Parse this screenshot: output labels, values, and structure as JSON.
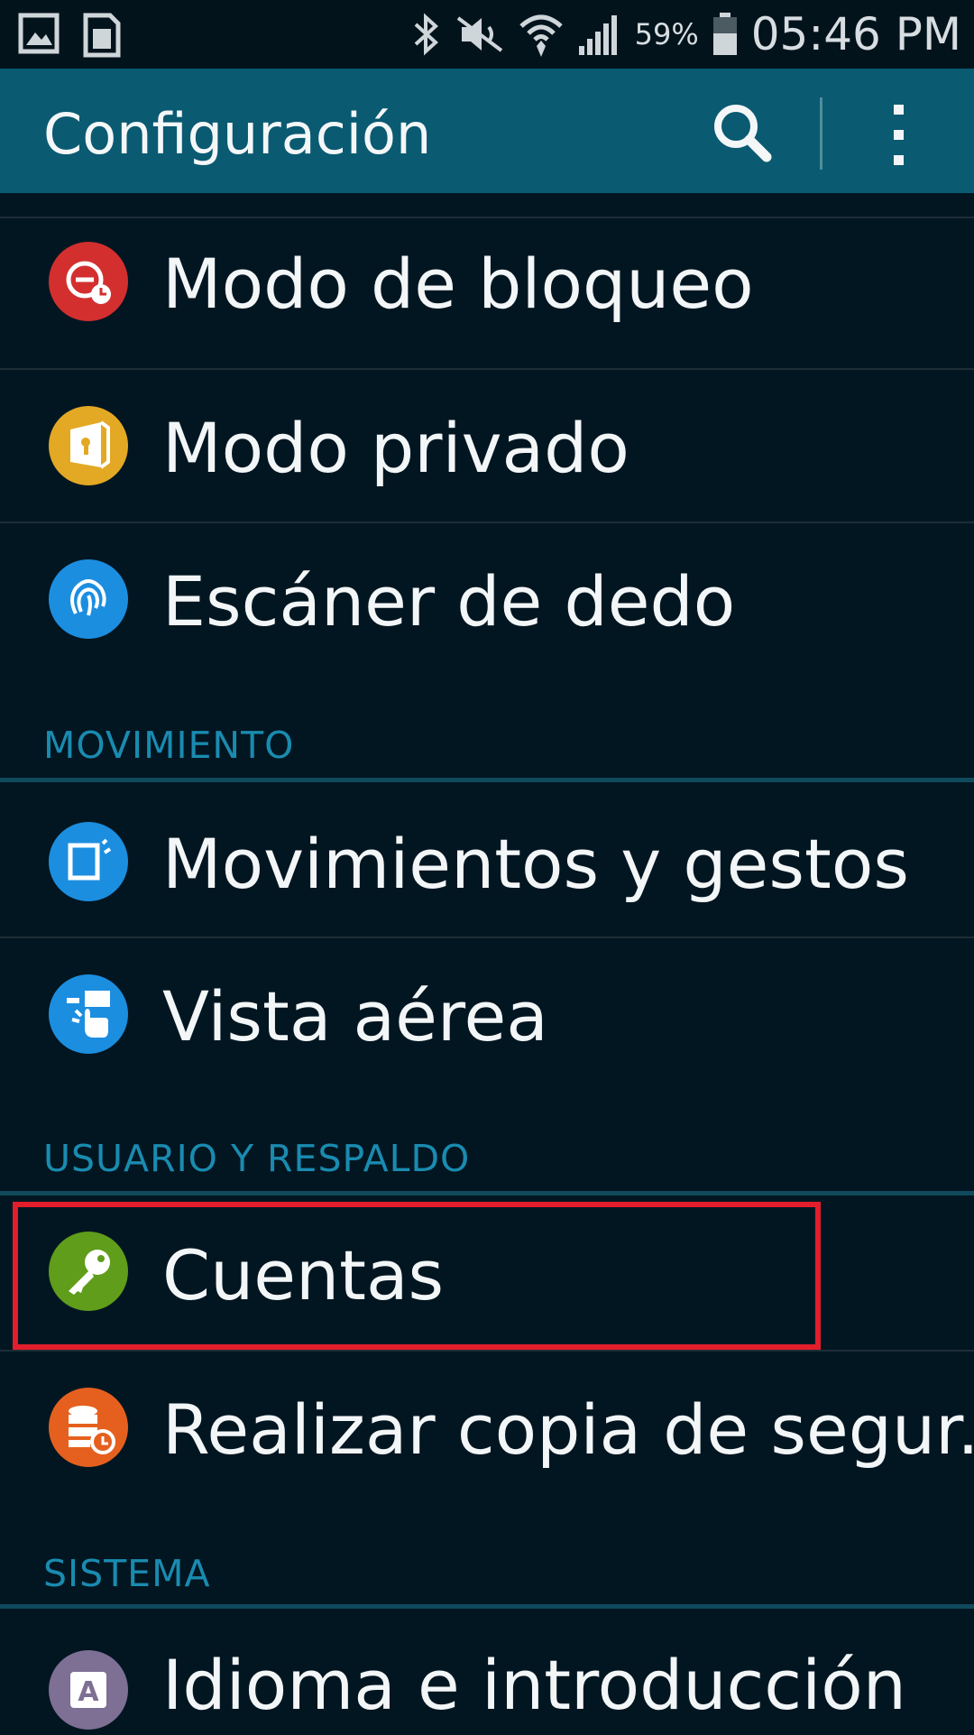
{
  "status_bar": {
    "battery_percent": "59%",
    "time": "05:46 PM"
  },
  "action_bar": {
    "title": "Configuración"
  },
  "sections": [
    {
      "header": "",
      "items": [
        {
          "label": "Modo de bloqueo",
          "icon": "blocking-mode-icon",
          "color": "#d32f2f"
        },
        {
          "label": "Modo privado",
          "icon": "private-mode-icon",
          "color": "#e3a824"
        },
        {
          "label": "Escáner de dedo",
          "icon": "fingerprint-icon",
          "color": "#1c8ee0"
        }
      ]
    },
    {
      "header": "MOVIMIENTO",
      "items": [
        {
          "label": "Movimientos y gestos",
          "icon": "motions-gestures-icon",
          "color": "#1c8ee0"
        },
        {
          "label": "Vista aérea",
          "icon": "air-view-icon",
          "color": "#1c8ee0"
        }
      ]
    },
    {
      "header": "USUARIO Y RESPALDO",
      "items": [
        {
          "label": "Cuentas",
          "icon": "key-icon",
          "color": "#5f9d1b"
        },
        {
          "label": "Realizar copia de segur..",
          "icon": "backup-icon",
          "color": "#e5601e"
        }
      ]
    },
    {
      "header": "SISTEMA",
      "items": [
        {
          "label": "Idioma e introducción",
          "icon": "language-icon",
          "color": "#7e6f94"
        }
      ]
    }
  ],
  "colors": {
    "background": "#021621",
    "action_bar": "#0a5a72",
    "section_header": "#1a8bb0",
    "highlight": "#e31e2c"
  }
}
